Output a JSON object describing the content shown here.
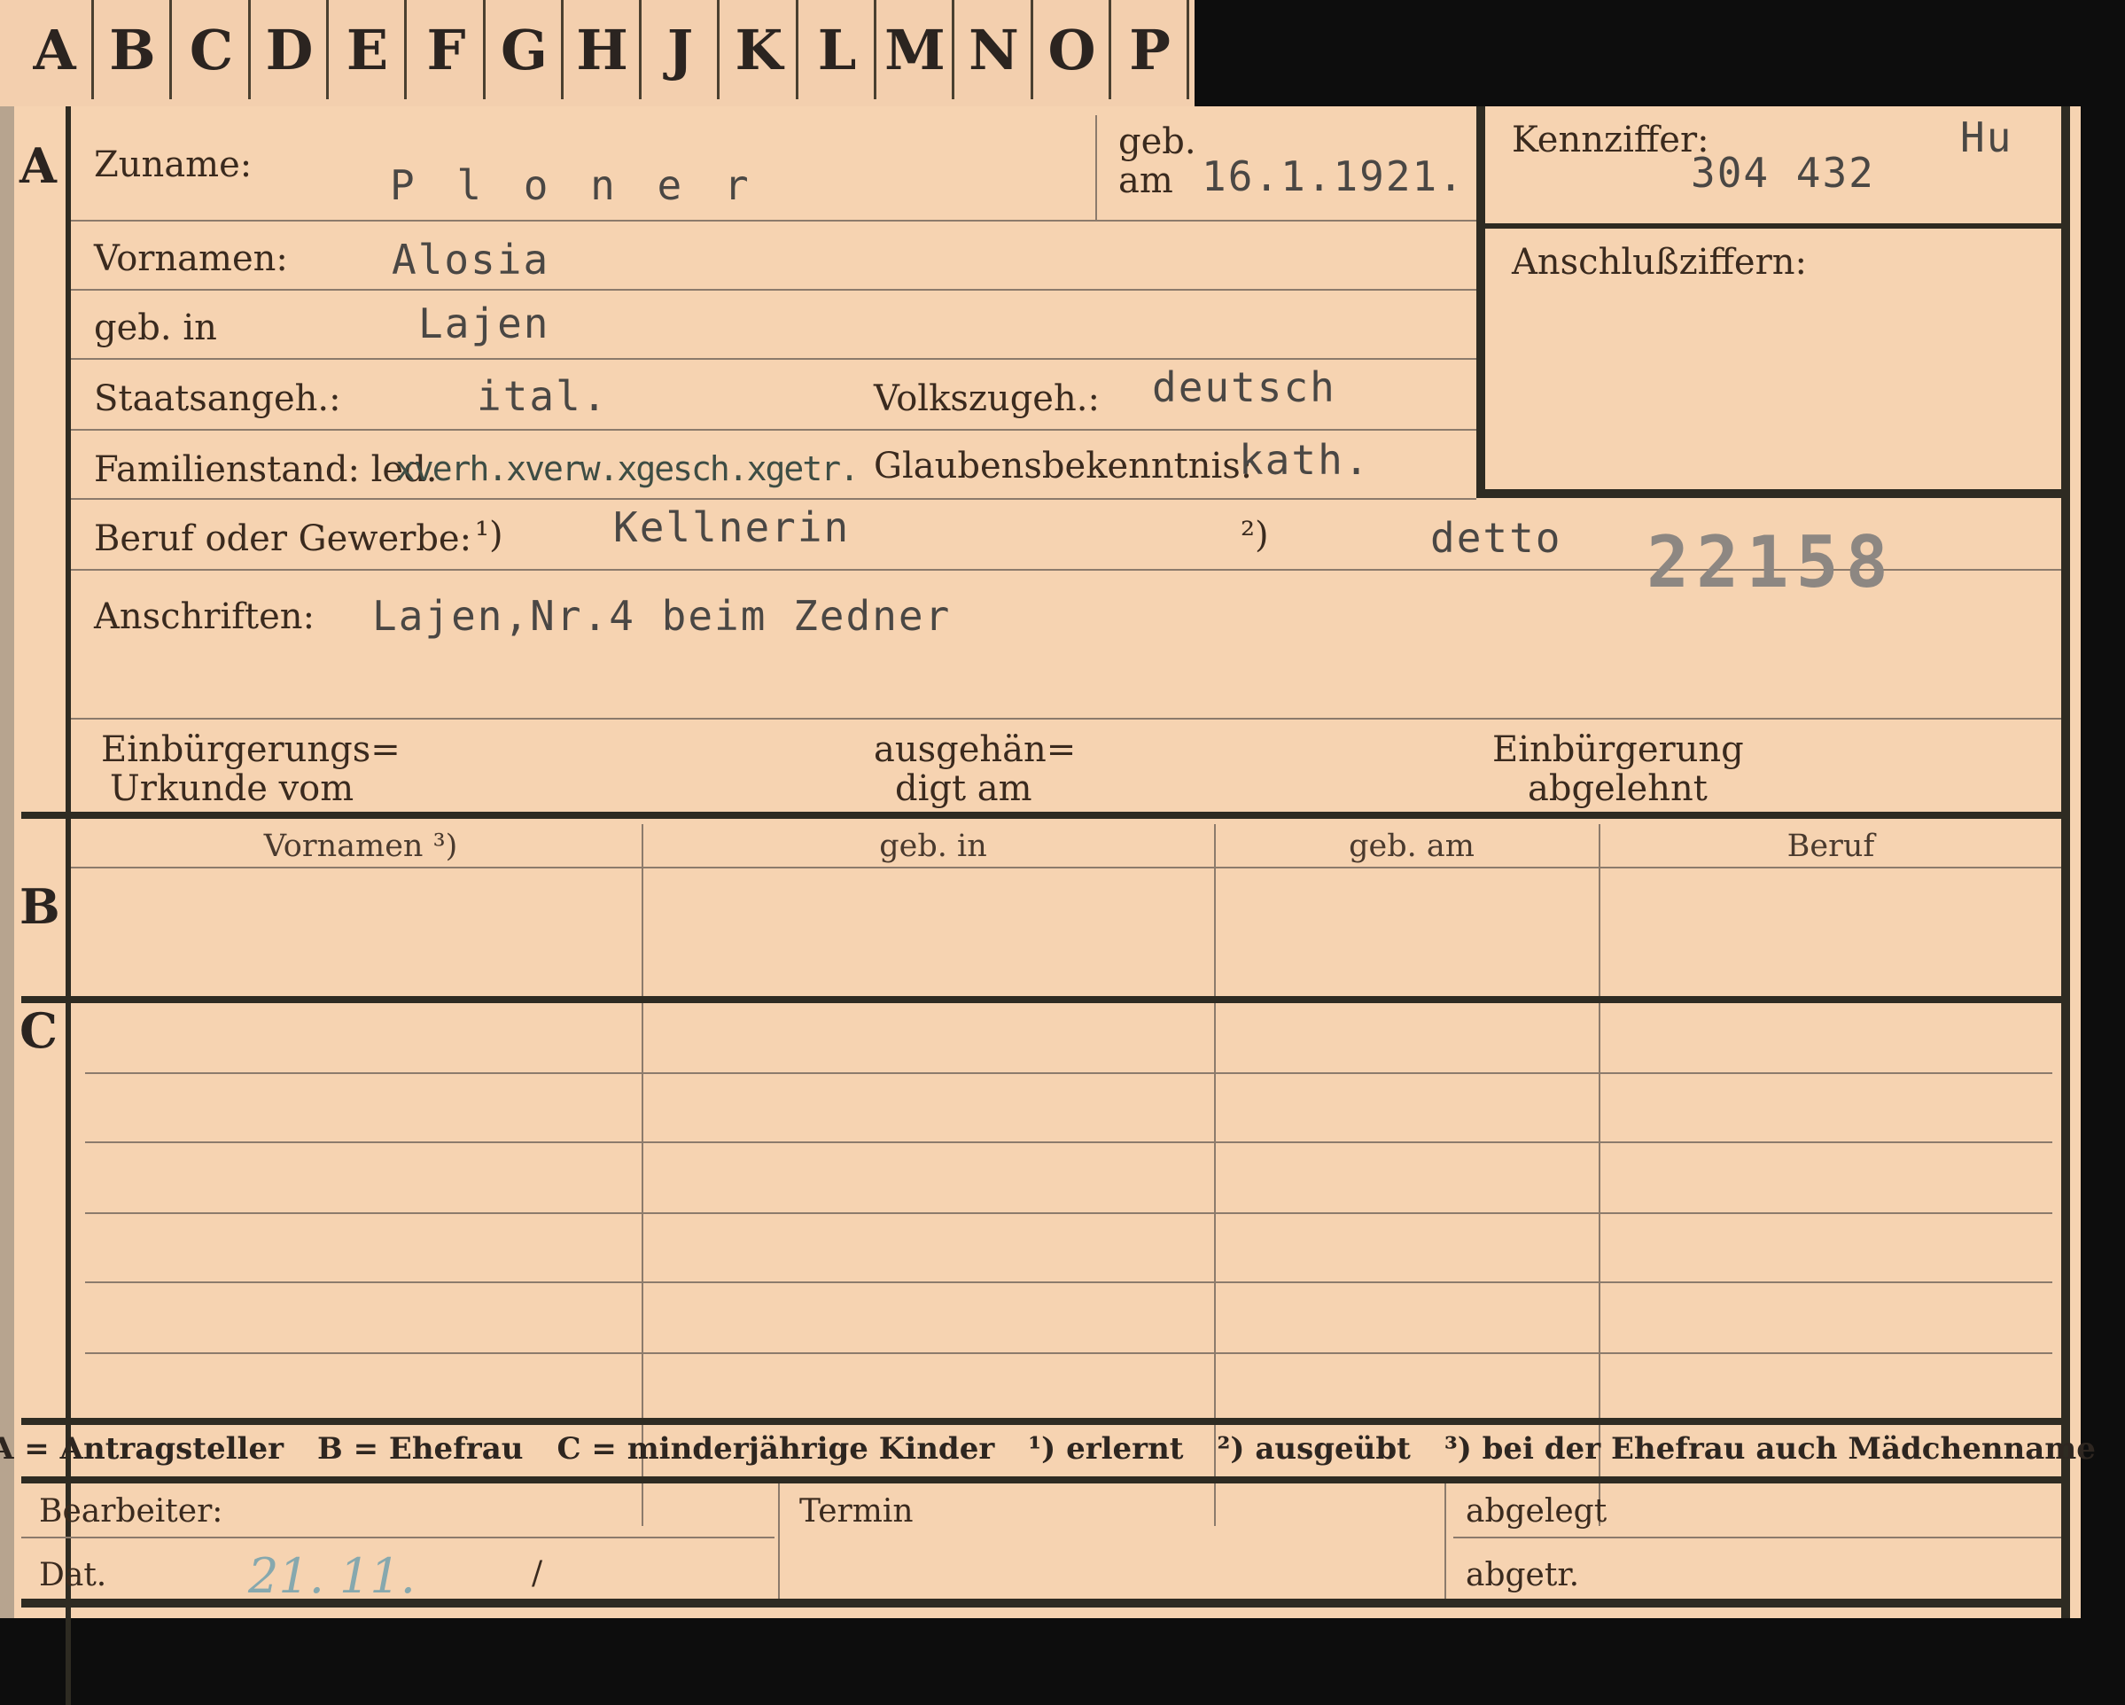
{
  "tabs": [
    "A",
    "B",
    "C",
    "D",
    "E",
    "F",
    "G",
    "H",
    "J",
    "K",
    "L",
    "M",
    "N",
    "O",
    "P"
  ],
  "section_labels": {
    "a": "A",
    "b": "B",
    "c": "C"
  },
  "labels": {
    "zuname": "Zuname:",
    "geb_line1": "geb.",
    "geb_line2": "am",
    "vornamen": "Vornamen:",
    "geb_in": "geb. in",
    "staatsangeh": "Staatsangeh.:",
    "volkszugeh": "Volkszugeh.:",
    "familienstand": "Familienstand: led.",
    "glaubensbekenntnis": "Glaubensbekenntnis:",
    "beruf": "Beruf oder Gewerbe:",
    "note1": "¹)",
    "note2": "²)",
    "anschriften": "Anschriften:",
    "kennziffer": "Kennziffer:",
    "anschlussziffern": "Anschlußziffern:",
    "einbuergerungs_urkunde_1": "Einbürgerungs=",
    "einbuergerungs_urkunde_2": "Urkunde vom",
    "ausgehaendigt_1": "ausgehän=",
    "ausgehaendigt_2": "digt am",
    "einbuergerung_abgelehnt_1": "Einbürgerung",
    "einbuergerung_abgelehnt_2": "abgelehnt"
  },
  "values": {
    "zuname": "P l o n e r",
    "geb_am": "16.1.1921.",
    "vornamen": "Alosia",
    "geb_in": "Lajen",
    "staatsangeh": "ital.",
    "volkszugeh": "deutsch",
    "familienstand_struck": "xverh.xverw.xgesch.xgetr.",
    "glaubensbekenntnis": "kath.",
    "beruf_erlernt": "Kellnerin",
    "beruf_ausgeuebt": "detto",
    "anschriften": "Lajen,Nr.4 beim Zedner",
    "kennziffer": "304 432",
    "kennziffer_prefix": "Hu",
    "stamp_number": "22158"
  },
  "section_b_headers": [
    "Vornamen ³)",
    "geb. in",
    "geb. am",
    "Beruf"
  ],
  "footer_legend": [
    "A = Antragsteller",
    "B = Ehefrau",
    "C = minderjährige Kinder",
    "¹) erlernt",
    "²) ausgeübt",
    "³) bei der Ehefrau auch Mädchenname"
  ],
  "bottom": {
    "bearbeiter": "Bearbeiter:",
    "dat": "Dat.",
    "dat_handwritten": "21. 11.",
    "dat_slash": "/",
    "termin": "Termin",
    "abgelegt": "abgelegt",
    "abgetr": "abgetr."
  },
  "colors": {
    "card": "#f6d3b1",
    "thick_rule": "#2e2b22",
    "typewriter": "#4a4744",
    "stamp": "#8d8782",
    "strikeout_ink": "#3e4d44",
    "handwriting": "#86a8ae"
  }
}
